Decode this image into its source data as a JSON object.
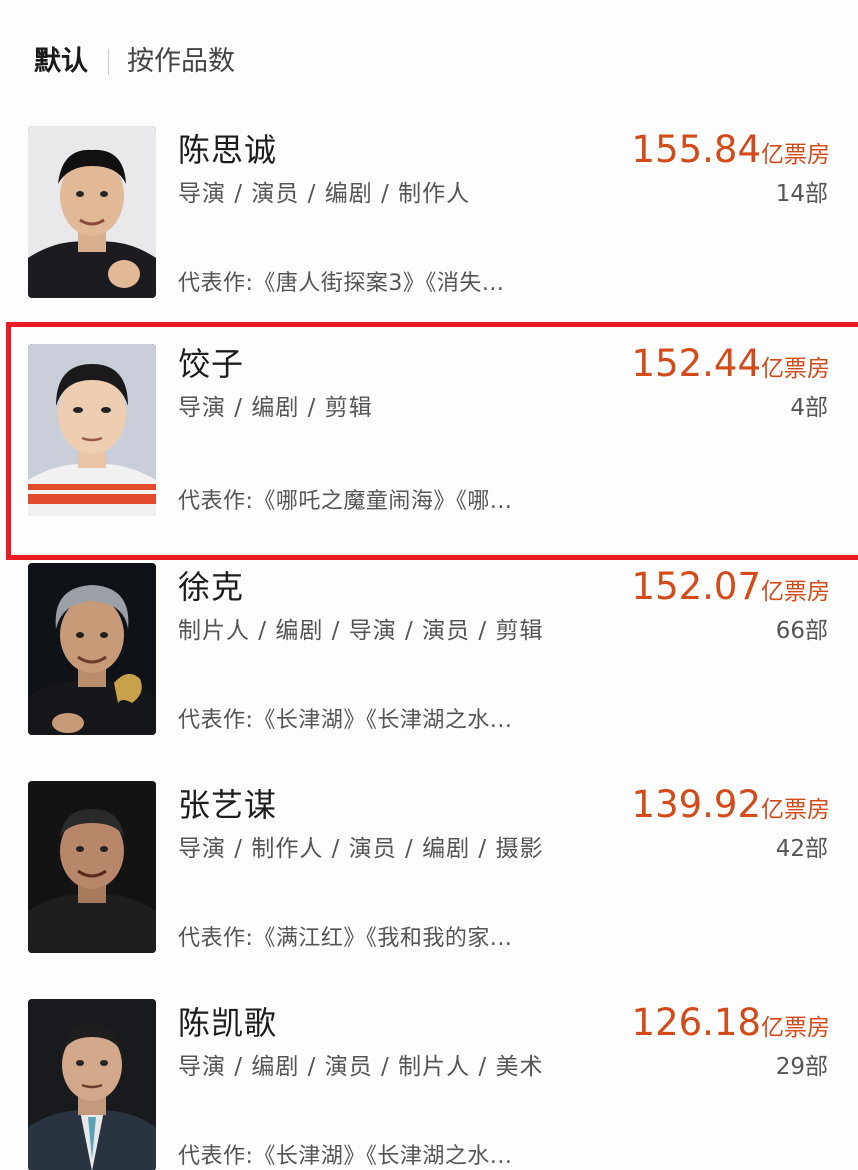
{
  "sort": {
    "default_label": "默认",
    "by_works_label": "按作品数"
  },
  "accent_color": "#d24b19",
  "highlight_color": "#ea1c24",
  "directors": [
    {
      "name": "陈思诚",
      "roles": "导演 / 演员 / 编剧 / 制作人",
      "works": "代表作:《唐人街探案3》《消失...",
      "box_office": "155.84",
      "unit": "亿票房",
      "count": "14部"
    },
    {
      "name": "饺子",
      "roles": "导演 / 编剧 / 剪辑",
      "works": "代表作:《哪吒之魔童闹海》《哪...",
      "box_office": "152.44",
      "unit": "亿票房",
      "count": "4部",
      "highlighted": true
    },
    {
      "name": "徐克",
      "roles": "制片人 / 编剧 / 导演 / 演员 / 剪辑",
      "works": "代表作:《长津湖》《长津湖之水...",
      "box_office": "152.07",
      "unit": "亿票房",
      "count": "66部"
    },
    {
      "name": "张艺谋",
      "roles": "导演 / 制作人 / 演员 / 编剧 / 摄影",
      "works": "代表作:《满江红》《我和我的家...",
      "box_office": "139.92",
      "unit": "亿票房",
      "count": "42部"
    },
    {
      "name": "陈凯歌",
      "roles": "导演 / 编剧 / 演员 / 制片人 / 美术",
      "works": "代表作:《长津湖》《长津湖之水...",
      "box_office": "126.18",
      "unit": "亿票房",
      "count": "29部"
    }
  ]
}
